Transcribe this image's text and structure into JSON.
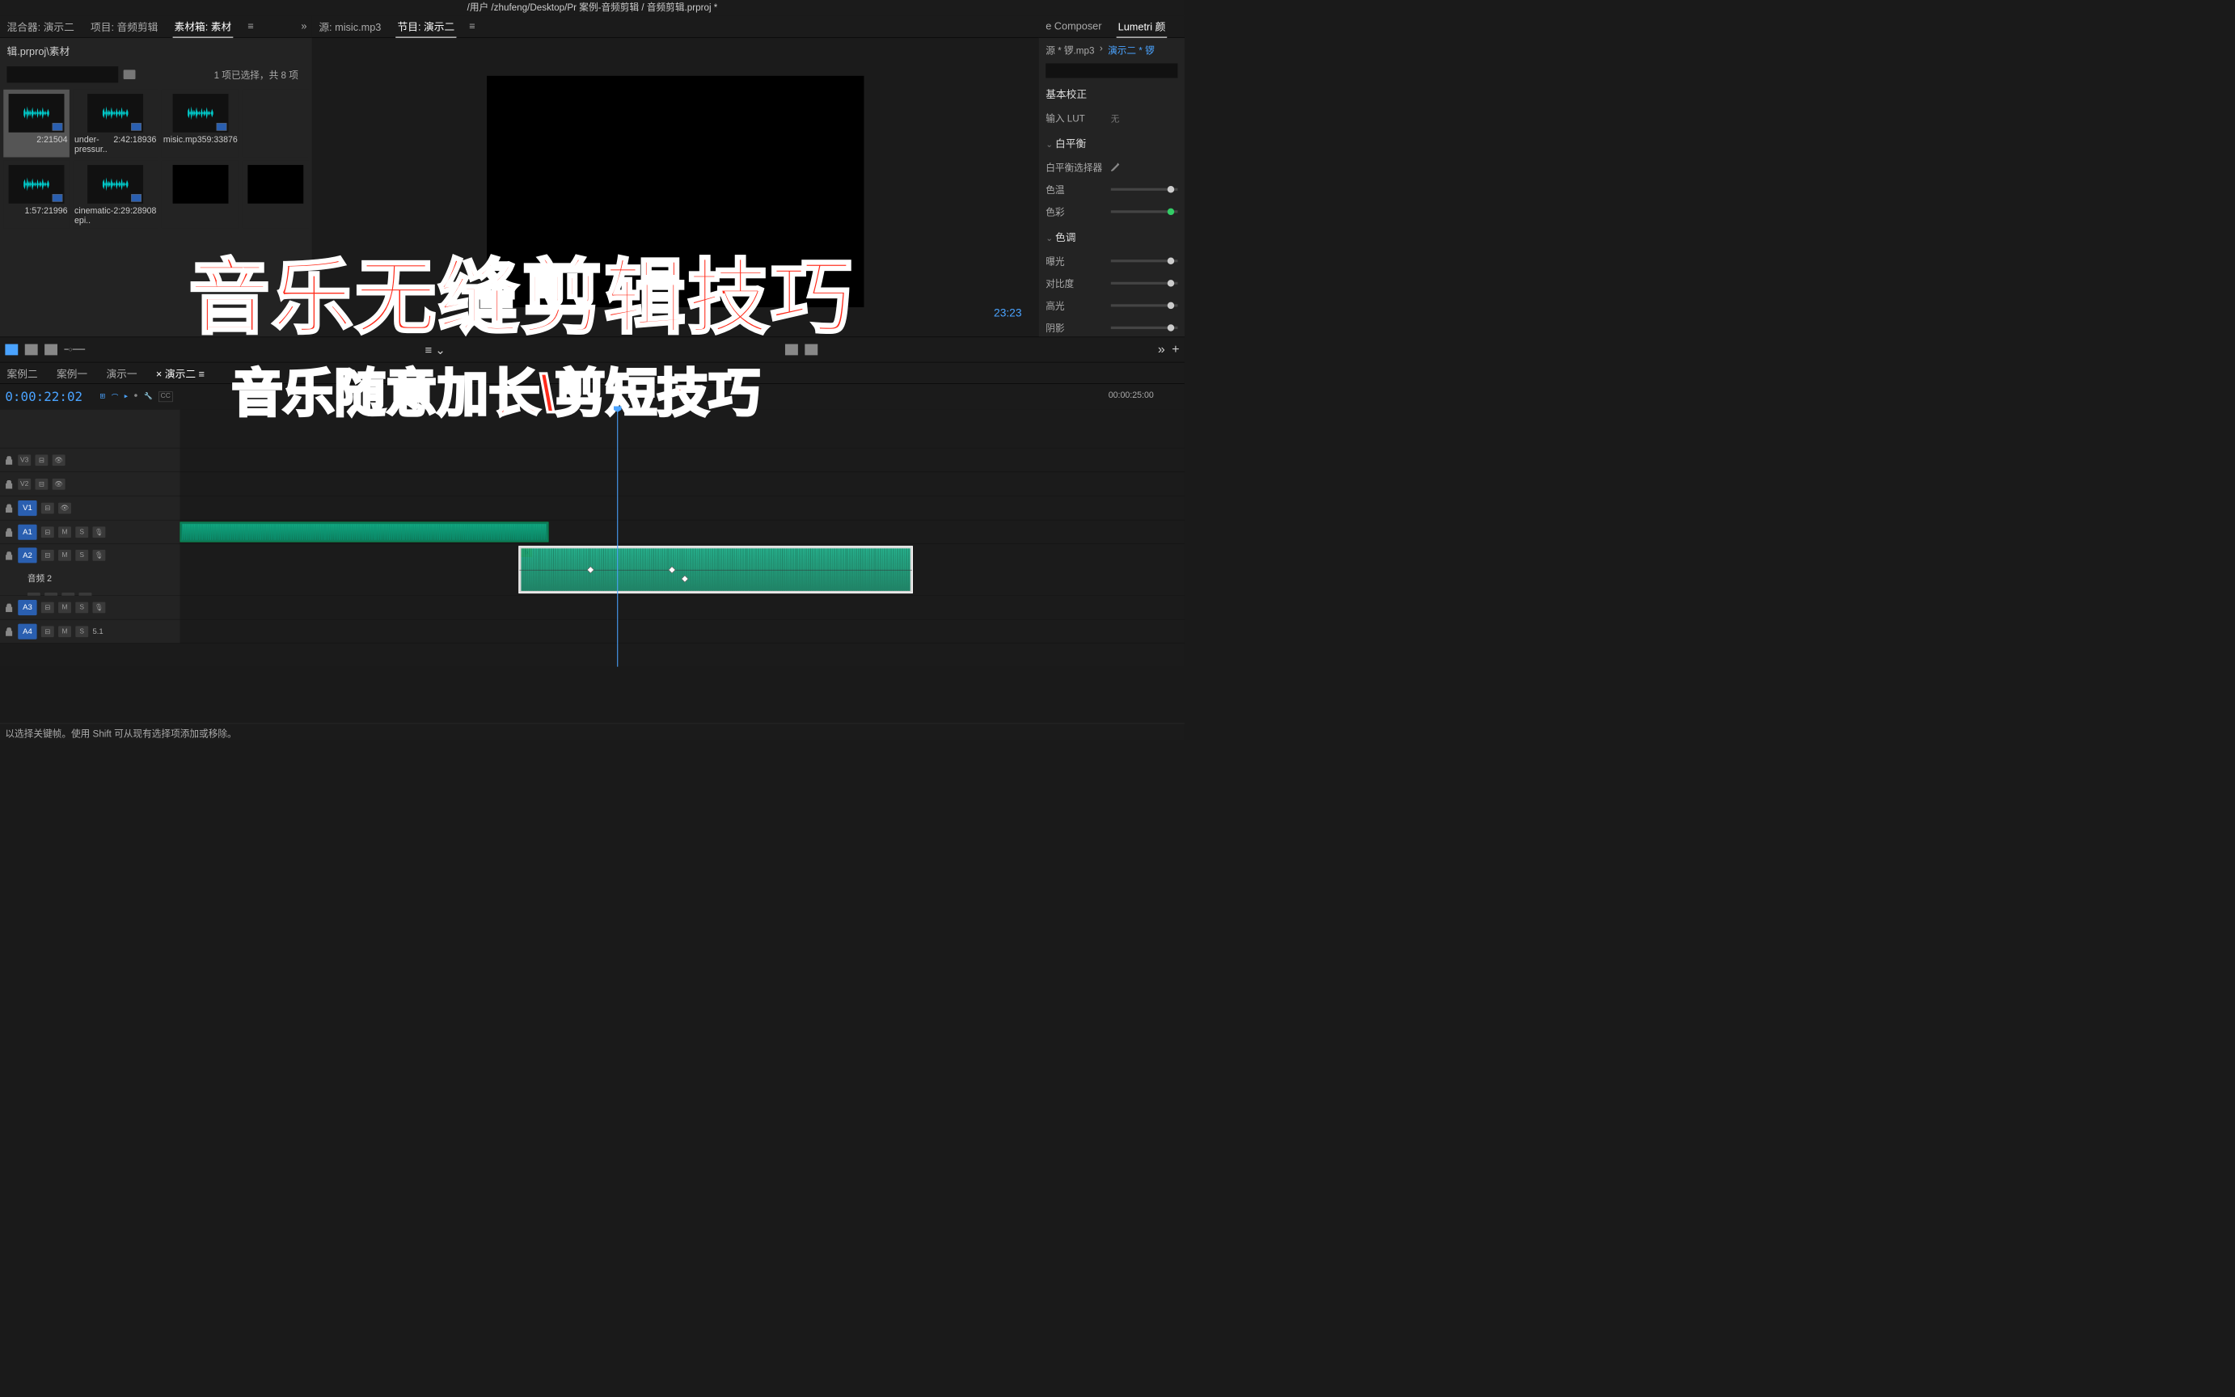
{
  "title_bar": "/用户 /zhufeng/Desktop/Pr 案例-音频剪辑 / 音频剪辑.prproj *",
  "left_tabs": {
    "mixer": "混合器: 演示二",
    "project": "项目: 音频剪辑",
    "bin": "素材箱: 素材",
    "more": "»"
  },
  "breadcrumb": "辑.prproj\\素材",
  "selection_info": "1 项已选择，共 8 项",
  "bins": [
    {
      "name": "",
      "dur": "2:21504",
      "sel": true
    },
    {
      "name": "under-pressur..",
      "dur": "2:42:18936"
    },
    {
      "name": "misic.mp3",
      "dur": "59:33876"
    },
    {
      "name": "",
      "dur": ""
    },
    {
      "name": "",
      "dur": "1:57:21996"
    },
    {
      "name": "cinematic-epi..",
      "dur": "2:29:28908"
    },
    {
      "name": "",
      "dur": ""
    }
  ],
  "center_tabs": {
    "source": "源: misic.mp3",
    "program": "节目: 演示二"
  },
  "program_tc": "23:23",
  "right_tabs": {
    "composer": "e Composer",
    "lumetri": "Lumetri 颜"
  },
  "lumetri": {
    "src": "源 * 锣.mp3",
    "seq": "演示二 * 锣",
    "basic": "基本校正",
    "lut_lbl": "输入 LUT",
    "lut_val": "无",
    "wb": "白平衡",
    "wb_picker": "白平衡选择器",
    "temp": "色温",
    "tint": "色彩",
    "tone": "色调",
    "exposure": "曝光",
    "contrast": "对比度",
    "highlights": "高光",
    "shadows": "阴影"
  },
  "timeline_tabs": [
    "案例二",
    "案例一",
    "演示一",
    "演示二"
  ],
  "timeline_active": 3,
  "timecode": "0:00:22:02",
  "ruler_label": "00:00:25:00",
  "tracks": {
    "v3": "V3",
    "v2": "V2",
    "v1": "V1",
    "a1": "A1",
    "a2": "A2",
    "a3": "A3",
    "a4": "A4",
    "audio2_name": "音频 2",
    "btn_m": "M",
    "btn_s": "S",
    "mix": "5.1"
  },
  "status": "以选择关键帧。使用 Shift 可从现有选择项添加或移除。",
  "overlay": {
    "line1": "音乐无缝剪辑技巧",
    "line2": "音乐随意加长\\剪短技巧"
  }
}
